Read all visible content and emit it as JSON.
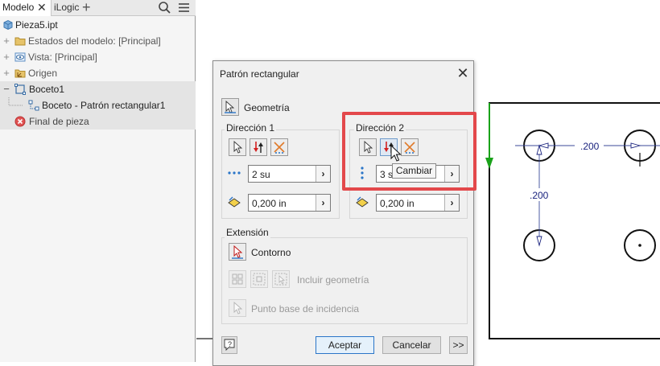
{
  "browser": {
    "tabs": {
      "model": "Modelo",
      "ilogic": "iLogic"
    },
    "tree": [
      {
        "label": "Pieza5.ipt",
        "icon": "part-file-icon"
      },
      {
        "label": "Estados del modelo: [Principal]",
        "icon": "folder-icon"
      },
      {
        "label": "Vista: [Principal]",
        "icon": "view-eye-icon"
      },
      {
        "label": "Origen",
        "icon": "origin-folder-icon"
      },
      {
        "label": "Boceto1",
        "icon": "sketch-icon"
      },
      {
        "label": "Boceto - Patrón rectangular1",
        "icon": "pattern-icon"
      },
      {
        "label": "Final de pieza",
        "icon": "end-of-part-icon"
      }
    ]
  },
  "canvas": {
    "dim_horizontal": ".200",
    "dim_vertical": ".200"
  },
  "dialog": {
    "title": "Patrón rectangular",
    "geometry_label": "Geometría",
    "direction1": {
      "title": "Dirección 1",
      "count": "2 su",
      "spacing": "0,200 in"
    },
    "direction2": {
      "title": "Dirección 2",
      "count": "3 su",
      "spacing": "0,200 in"
    },
    "extension": {
      "title": "Extensión",
      "contour_label": "Contorno",
      "include_geometry_label": "Incluir geometría",
      "base_point_label": "Punto base de incidencia"
    },
    "buttons": {
      "accept": "Aceptar",
      "cancel": "Cancelar",
      "more": ">>"
    }
  },
  "tooltip": "Cambiar",
  "colors": {
    "highlight": "#e3484b",
    "dimension_text": "#1a237e",
    "axis_green": "#1aa21a",
    "selection_blue": "#2a75c8"
  }
}
